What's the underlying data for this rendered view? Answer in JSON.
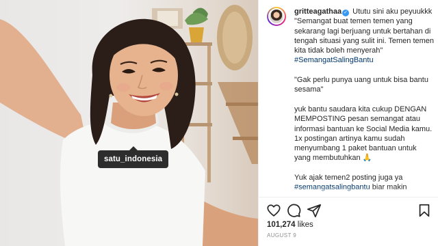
{
  "post": {
    "tag_label": "satu_indonesia",
    "username": "gritteagathaa",
    "caption": {
      "intro": " Ututu sini aku peyuukkk \"Semangat buat temen temen yang sekarang lagi berjuang untuk bertahan di tengah situasi yang sulit ini. Temen temen kita tidak boleh menyerah\" ",
      "hashtag": "#SemangatSalingBantu",
      "quote": "\"Gak perlu punya uang untuk bisa bantu sesama\"",
      "body": "yuk bantu saudara kita cukup DENGAN MEMPOSTING pesan semangat atau informasi bantuan ke Social Media kamu. 1x postingan artinya kamu sudah menyumbang 1 paket bantuan untuk yang membutuhkan 🙏",
      "closing": "Yuk ajak temen2 posting juga ya ",
      "closing_hashtag": "#semangatsalingbantu",
      "closing_tail": " biar makin"
    },
    "likes_count": "101,274",
    "likes_unit": "likes",
    "date": "AUGUST 9"
  },
  "icons": {
    "like": "heart-icon",
    "comment": "comment-icon",
    "share": "share-icon",
    "save": "bookmark-icon",
    "verified": "verified-badge-icon"
  },
  "colors": {
    "text": "#262626",
    "hashtag": "#00376b",
    "verified": "#3897f0",
    "muted": "#8e8e8e",
    "tag_bg": "#000000"
  }
}
